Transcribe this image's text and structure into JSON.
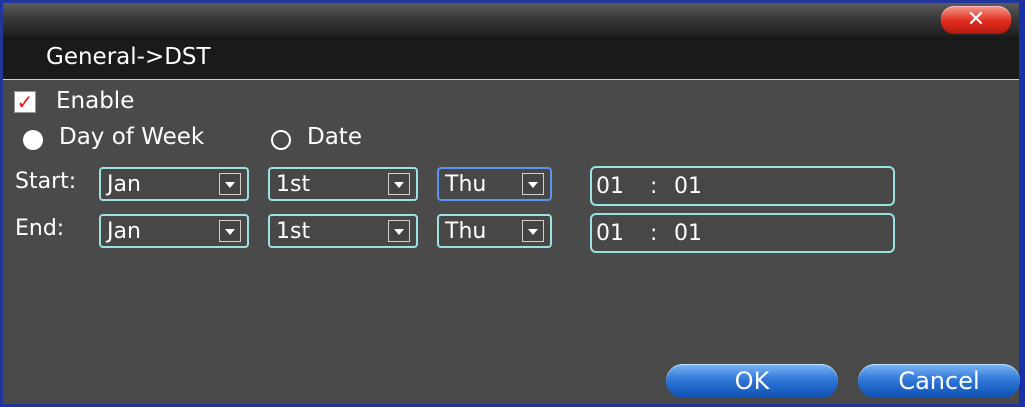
{
  "window": {
    "title": "General->DST",
    "close_glyph": "✕"
  },
  "enable": {
    "label": "Enable",
    "checked": true,
    "mark": "✓"
  },
  "mode": {
    "options": [
      {
        "label": "Day of Week",
        "selected": true
      },
      {
        "label": "Date",
        "selected": false
      }
    ]
  },
  "rows": {
    "start": {
      "label": "Start:",
      "month": "Jan",
      "week": "1st",
      "day": "Thu",
      "hour": "01",
      "minute": "01",
      "sep": ":"
    },
    "end": {
      "label": "End:",
      "month": "Jan",
      "week": "1st",
      "day": "Thu",
      "hour": "01",
      "minute": "01",
      "sep": ":"
    }
  },
  "buttons": {
    "ok": "OK",
    "cancel": "Cancel"
  },
  "colors": {
    "accent": "#9be2e0",
    "focus": "#5a94f0",
    "close": "#e02a1c",
    "button": "#2f78d8"
  }
}
